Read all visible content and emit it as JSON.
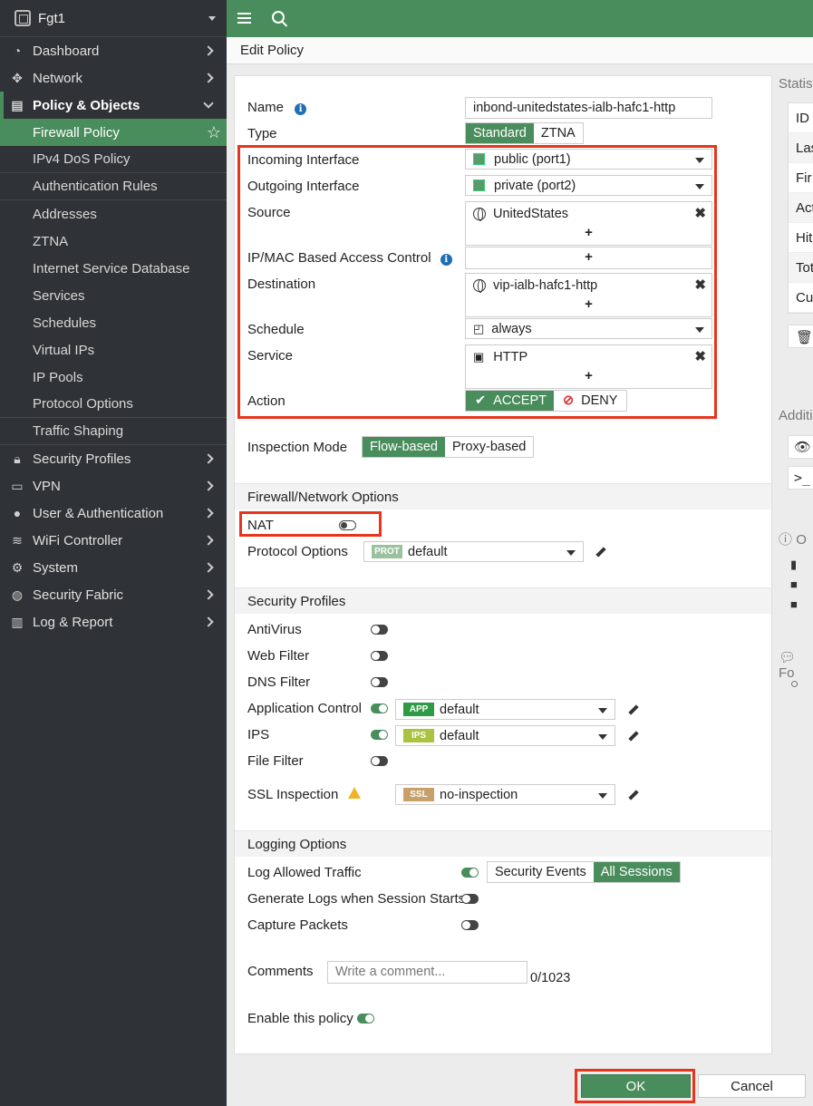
{
  "device": {
    "name": "Fgt1"
  },
  "sidebar": {
    "items": [
      {
        "label": "Dashboard",
        "icon": "dashboard-icon"
      },
      {
        "label": "Network",
        "icon": "network-icon"
      },
      {
        "label": "Policy & Objects",
        "icon": "clipboard-icon"
      }
    ],
    "policy_sub": [
      "Firewall Policy",
      "IPv4 DoS Policy",
      "Authentication Rules",
      "Addresses",
      "ZTNA",
      "Internet Service Database",
      "Services",
      "Schedules",
      "Virtual IPs",
      "IP Pools",
      "Protocol Options",
      "Traffic Shaping"
    ],
    "lower": [
      {
        "label": "Security Profiles",
        "icon": "lock-icon"
      },
      {
        "label": "VPN",
        "icon": "laptop-icon"
      },
      {
        "label": "User & Authentication",
        "icon": "user-icon"
      },
      {
        "label": "WiFi Controller",
        "icon": "wifi-icon"
      },
      {
        "label": "System",
        "icon": "gear-icon"
      },
      {
        "label": "Security Fabric",
        "icon": "fabric-icon"
      },
      {
        "label": "Log & Report",
        "icon": "chart-icon"
      }
    ]
  },
  "page": {
    "title": "Edit Policy"
  },
  "form": {
    "name_label": "Name",
    "name_value": "inbond-unitedstates-ialb-hafc1-http",
    "type_label": "Type",
    "type_options": [
      "Standard",
      "ZTNA"
    ],
    "incoming_label": "Incoming Interface",
    "incoming_value": "public (port1)",
    "outgoing_label": "Outgoing Interface",
    "outgoing_value": "private (port2)",
    "source_label": "Source",
    "source_value": "UnitedStates",
    "ipmac_label": "IP/MAC Based Access Control",
    "destination_label": "Destination",
    "destination_value": "vip-ialb-hafc1-http",
    "schedule_label": "Schedule",
    "schedule_value": "always",
    "service_label": "Service",
    "service_value": "HTTP",
    "action_label": "Action",
    "action_accept": "ACCEPT",
    "action_deny": "DENY",
    "plus": "+",
    "inspection_label": "Inspection Mode",
    "inspection_options": [
      "Flow-based",
      "Proxy-based"
    ]
  },
  "fw_options": {
    "header": "Firewall/Network Options",
    "nat_label": "NAT",
    "protocol_label": "Protocol Options",
    "protocol_badge": "PROT",
    "protocol_value": "default"
  },
  "security_profiles": {
    "header": "Security Profiles",
    "antivirus": "AntiVirus",
    "webfilter": "Web Filter",
    "dnsfilter": "DNS Filter",
    "appcontrol": "Application Control",
    "app_badge": "APP",
    "app_value": "default",
    "ips": "IPS",
    "ips_badge": "IPS",
    "ips_value": "default",
    "filefilter": "File Filter",
    "ssl": "SSL Inspection",
    "ssl_badge": "SSL",
    "ssl_value": "no-inspection"
  },
  "logging": {
    "header": "Logging Options",
    "log_allowed": "Log Allowed Traffic",
    "log_options": [
      "Security Events",
      "All Sessions"
    ],
    "gen_logs": "Generate Logs when Session Starts",
    "capture": "Capture Packets",
    "comments_label": "Comments",
    "comments_placeholder": "Write a comment...",
    "comments_count": "0/1023",
    "enable": "Enable this policy"
  },
  "right_panel": {
    "stats_header": "Statisti",
    "rows": [
      "ID",
      "Las",
      "Fir",
      "Act",
      "Hit",
      "Tot",
      "Cu"
    ],
    "additional": "Additi",
    "online": "O",
    "fo": "Fo"
  },
  "buttons": {
    "ok": "OK",
    "cancel": "Cancel"
  },
  "colors": {
    "accent": "#4a8d5c",
    "highlight": "#e8341c",
    "sidebar": "#2f3236"
  }
}
